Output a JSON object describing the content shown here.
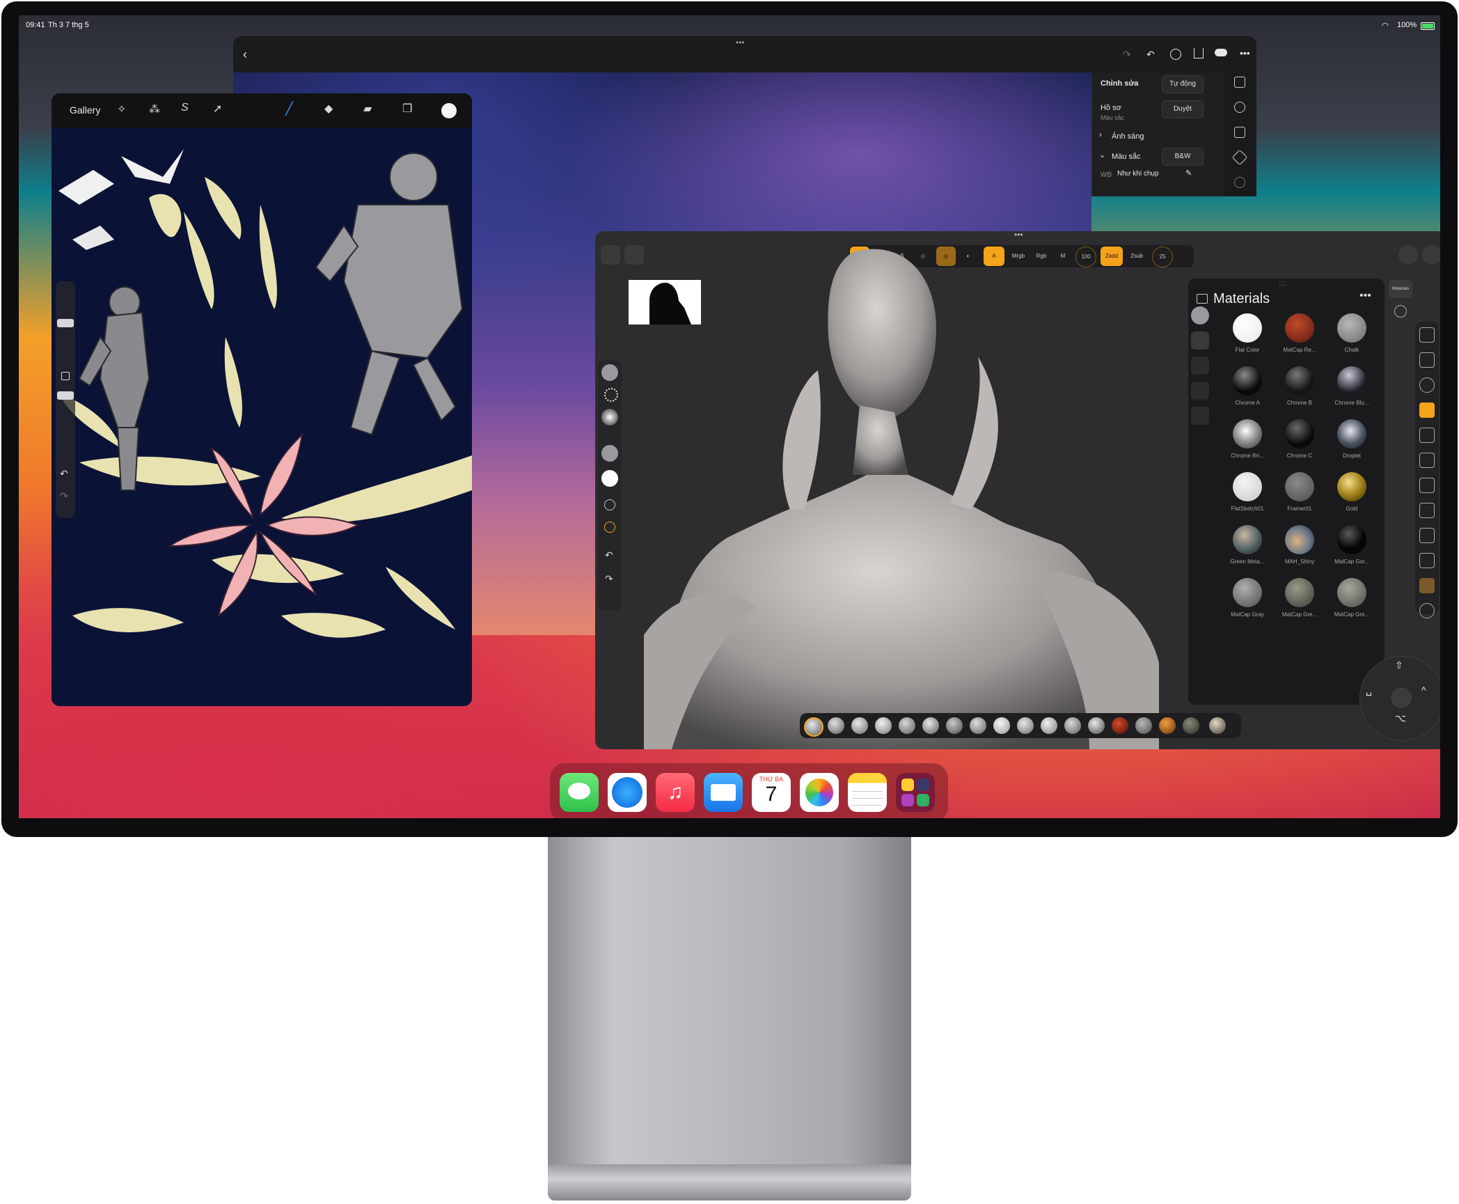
{
  "status_bar": {
    "time": "09:41",
    "date": "Th 3 7 thg 5",
    "battery": "100%"
  },
  "photo_editor": {
    "panel": {
      "edit_label": "Chỉnh sửa",
      "auto_button": "Tự động",
      "profile_label": "Hồ sơ",
      "profile_sub": "Màu sắc",
      "browse_button": "Duyệt",
      "light_label": "Ánh sáng",
      "color_label": "Màu sắc",
      "bw_button": "B&W",
      "wb_label": "WB",
      "wb_value": "Như khi chụp"
    }
  },
  "drawing_app": {
    "gallery": "Gallery"
  },
  "sculpt_app": {
    "toolbar": [
      "A",
      "Mrgb",
      "Rgb",
      "M",
      "Zadd",
      "Zsub"
    ],
    "toolbar_values": {
      "focal": "100",
      "intensity": "25"
    },
    "materials": {
      "title": "Materials",
      "tab_label": "Materials",
      "items": [
        {
          "name": "Flat Color",
          "color": "#f4f4f4"
        },
        {
          "name": "MatCap Re...",
          "color": "#8a2a1a"
        },
        {
          "name": "Chalk",
          "color": "#9a9a9a"
        },
        {
          "name": "Chrome A",
          "color": "#1c1c1c"
        },
        {
          "name": "Chrome B",
          "color": "#262626"
        },
        {
          "name": "Chrome Blu...",
          "color": "#3a3a44"
        },
        {
          "name": "Chrome Bri...",
          "color": "#d8d8d8"
        },
        {
          "name": "Chrome C",
          "color": "#1a1a1a"
        },
        {
          "name": "Droplet",
          "color": "#5a6070"
        },
        {
          "name": "FlatSketch01",
          "color": "#e4e4e4"
        },
        {
          "name": "Framer01",
          "color": "#6a6a6a"
        },
        {
          "name": "Gold",
          "color": "#a0801a"
        },
        {
          "name": "Green Meta...",
          "color": "#5e6a6a"
        },
        {
          "name": "MAH_Shiny",
          "color": "#6a7a8a"
        },
        {
          "name": "MatCap Gor...",
          "color": "#111111"
        },
        {
          "name": "MatCap Gray",
          "color": "#7a7a7a"
        },
        {
          "name": "MatCap Gre...",
          "color": "#5a5a50"
        },
        {
          "name": "MatCap Gre...",
          "color": "#6a6a62"
        }
      ]
    }
  },
  "dock": {
    "apps": [
      {
        "name": "Messages",
        "color": "#34c759"
      },
      {
        "name": "Safari",
        "color": "#1a8cf0"
      },
      {
        "name": "Music",
        "color": "#fa3c4c"
      },
      {
        "name": "Mail",
        "color": "#2a8cf4"
      },
      {
        "name": "Calendar",
        "color": "#ffffff",
        "weekday": "THỨ BA",
        "day": "7"
      },
      {
        "name": "Photos",
        "color": "#ffffff"
      },
      {
        "name": "Notes",
        "color": "#ffffff"
      },
      {
        "name": "App Library",
        "color": "#7a1a3a"
      }
    ]
  },
  "colors": {
    "accent_orange": "#f5a31a",
    "ipad_bezel": "#0d0d0f"
  }
}
